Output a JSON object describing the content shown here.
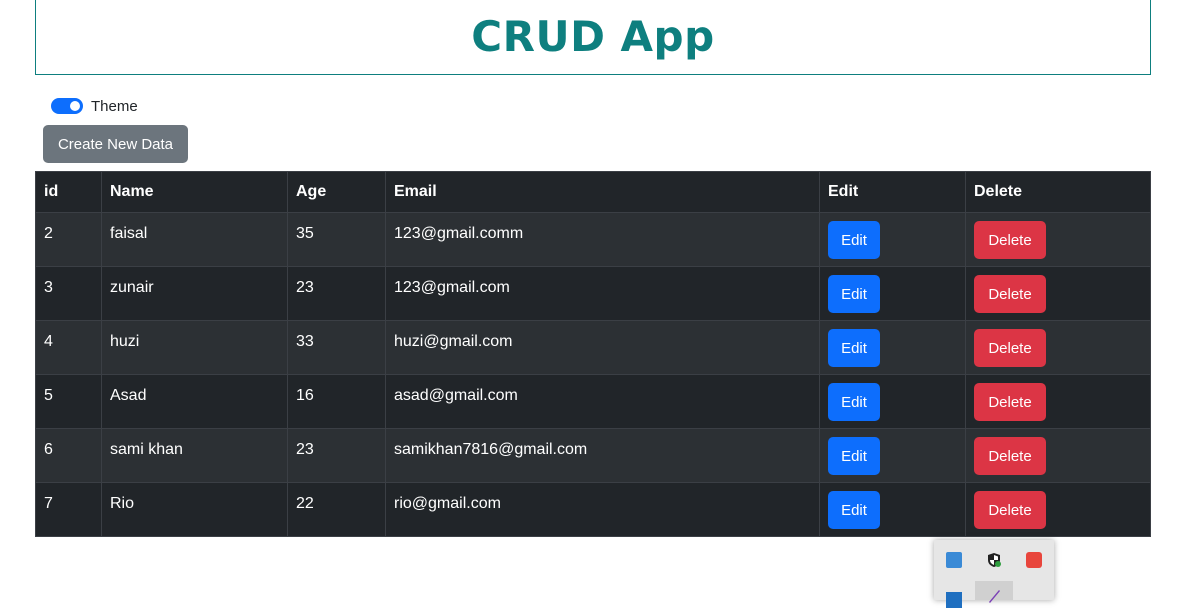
{
  "header": {
    "title": "CRUD App"
  },
  "theme": {
    "label": "Theme",
    "enabled": true
  },
  "create_button": "Create New Data",
  "table": {
    "columns": [
      "id",
      "Name",
      "Age",
      "Email",
      "Edit",
      "Delete"
    ],
    "edit_label": "Edit",
    "delete_label": "Delete",
    "rows": [
      {
        "id": "2",
        "name": "faisal",
        "age": "35",
        "email": "123@gmail.comm"
      },
      {
        "id": "3",
        "name": "zunair",
        "age": "23",
        "email": "123@gmail.com"
      },
      {
        "id": "4",
        "name": "huzi",
        "age": "33",
        "email": "huzi@gmail.com"
      },
      {
        "id": "5",
        "name": "Asad",
        "age": "16",
        "email": "asad@gmail.com"
      },
      {
        "id": "6",
        "name": "sami khan",
        "age": "23",
        "email": "samikhan7816@gmail.com"
      },
      {
        "id": "7",
        "name": "Rio",
        "age": "22",
        "email": "rio@gmail.com"
      }
    ]
  },
  "colors": {
    "title": "#0e7f7f",
    "primary": "#0d6efd",
    "secondary": "#6c757d",
    "danger": "#dc3545",
    "table_dark": "#212529",
    "table_stripe": "#2c3034"
  },
  "tray": {
    "icons": [
      "app-icon",
      "shield-icon",
      "remote-icon",
      "app-window-icon",
      "pen-icon"
    ]
  }
}
